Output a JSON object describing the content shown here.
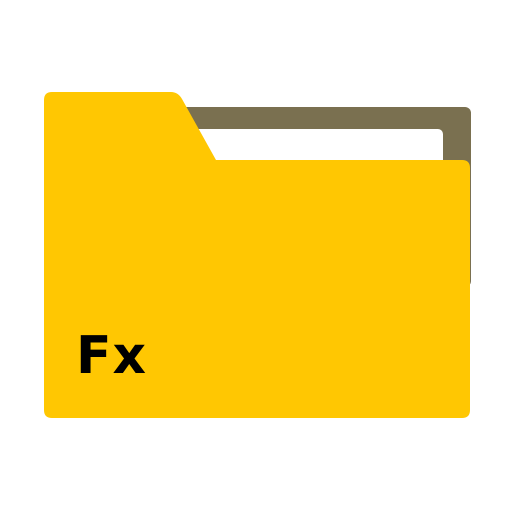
{
  "app_icon": {
    "name": "folder-icon",
    "label": "Fx",
    "colors": {
      "folder_front": "#FFC702",
      "folder_back": "#7A7050",
      "paper": "#FFFFFF",
      "label_text": "#000000"
    }
  }
}
